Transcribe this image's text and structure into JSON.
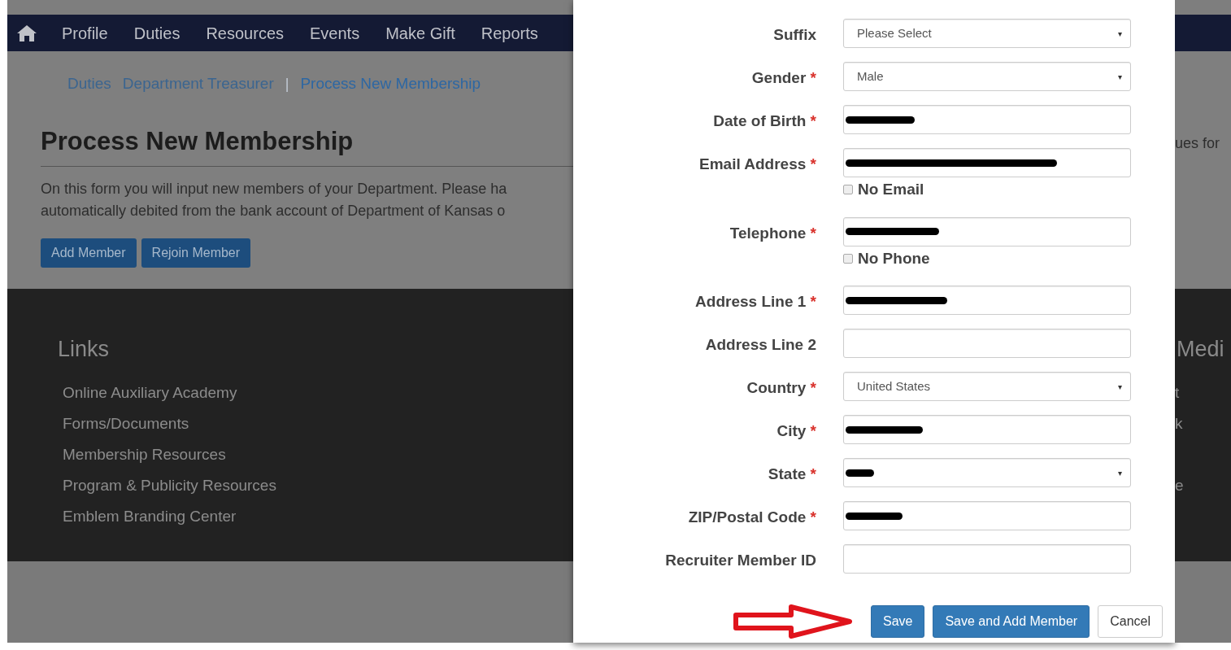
{
  "nav": {
    "items": [
      "Profile",
      "Duties",
      "Resources",
      "Events",
      "Make Gift",
      "Reports"
    ]
  },
  "breadcrumb_separator": "|",
  "breadcrumb": [
    {
      "label": "Duties",
      "selected": false
    },
    {
      "label": "Department Treasurer",
      "selected": false
    },
    {
      "label": "Process New Membership",
      "selected": true
    }
  ],
  "page": {
    "title": "Process New Membership",
    "intro_lines": [
      "On this form you will input new members of your Department. Please ha",
      "automatically debited from the bank account of Department of Kansas o"
    ],
    "intro_right": "ues for",
    "buttons": [
      "Add Member",
      "Rejoin Member"
    ]
  },
  "footer": {
    "links_title": "Links",
    "links": [
      "Online Auxiliary Academy",
      "Forms/Documents",
      "Membership Resources",
      "Program & Publicity Resources",
      "Emblem Branding Center"
    ],
    "right_title": "Medi",
    "right_items": [
      "t",
      "k",
      "e"
    ]
  },
  "form": {
    "required_mark": "*",
    "select_caret": "▾",
    "rows": [
      {
        "kind": "select",
        "label": "Suffix",
        "required": false,
        "value": "Please Select",
        "redacted": false
      },
      {
        "kind": "select",
        "label": "Gender",
        "required": true,
        "value": "Male",
        "redacted": false
      },
      {
        "kind": "text",
        "label": "Date of Birth",
        "required": true,
        "redacted": true
      },
      {
        "kind": "text",
        "label": "Email Address",
        "required": true,
        "redacted": true
      },
      {
        "kind": "checkbox",
        "label": "No Email",
        "checked": false
      },
      {
        "kind": "text",
        "label": "Telephone",
        "required": true,
        "redacted": true
      },
      {
        "kind": "checkbox",
        "label": "No Phone",
        "checked": false
      },
      {
        "kind": "text",
        "label": "Address Line 1",
        "required": true,
        "redacted": true
      },
      {
        "kind": "text",
        "label": "Address Line 2",
        "required": false,
        "redacted": false
      },
      {
        "kind": "select",
        "label": "Country",
        "required": true,
        "value": "United States",
        "redacted": false
      },
      {
        "kind": "text",
        "label": "City",
        "required": true,
        "redacted": true
      },
      {
        "kind": "select",
        "label": "State",
        "required": true,
        "redacted": true
      },
      {
        "kind": "text",
        "label": "ZIP/Postal Code",
        "required": true,
        "redacted": true
      },
      {
        "kind": "text",
        "label": "Recruiter Member ID",
        "required": false,
        "redacted": false
      }
    ],
    "buttons": [
      {
        "label": "Save",
        "kind": "primary"
      },
      {
        "label": "Save and Add Member",
        "kind": "primary"
      },
      {
        "label": "Cancel",
        "kind": "default"
      }
    ]
  }
}
